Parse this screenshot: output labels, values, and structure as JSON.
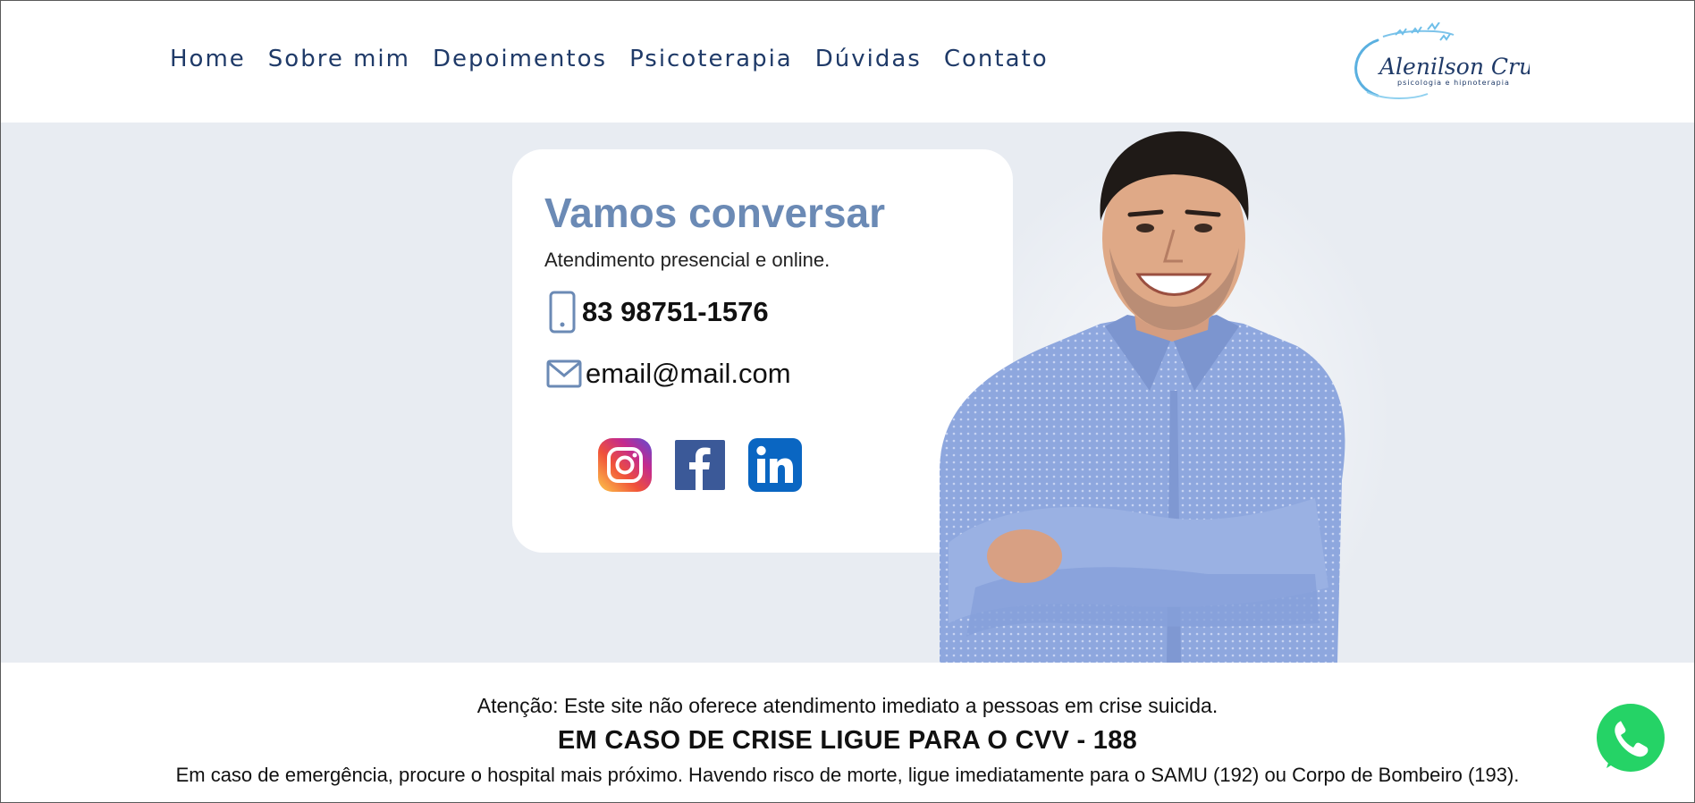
{
  "nav": {
    "items": [
      {
        "label": "Home"
      },
      {
        "label": "Sobre mim"
      },
      {
        "label": "Depoimentos"
      },
      {
        "label": "Psicoterapia"
      },
      {
        "label": "Dúvidas"
      },
      {
        "label": "Contato"
      }
    ]
  },
  "logo": {
    "name": "Alenilson Cruz",
    "tagline": "psicologia e hipnoterapia"
  },
  "contact": {
    "title": "Vamos conversar",
    "subtitle": "Atendimento presencial e online.",
    "phone": "83 98751-1576",
    "email": "email@mail.com",
    "icons": [
      "phone-icon",
      "mail-icon",
      "instagram-icon",
      "facebook-icon",
      "linkedin-icon"
    ]
  },
  "footer": {
    "warning": "Atenção: Este site não oferece atendimento imediato a pessoas em crise suicida.",
    "cvv": "EM CASO DE CRISE LIGUE PARA O CVV - 188",
    "emergency": "Em caso de emergência, procure o hospital mais próximo. Havendo risco de morte, ligue imediatamente para o SAMU (192) ou Corpo de Bombeiro (193)."
  },
  "colors": {
    "nav": "#1f3a68",
    "title": "#6b8ab5",
    "hero_bg": "#e8ecf2",
    "whatsapp": "#25d366"
  }
}
